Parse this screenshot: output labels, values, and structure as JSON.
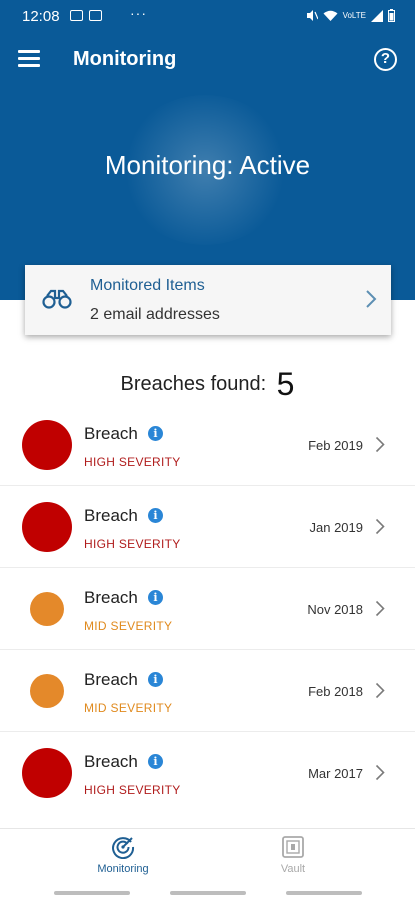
{
  "status_bar": {
    "time": "12:08",
    "more": "···",
    "right_text": "VoLTE"
  },
  "app_bar": {
    "title": "Monitoring",
    "menu_icon": "hamburger-menu-icon",
    "help_icon": "help-circle-icon",
    "help_glyph": "?"
  },
  "hero": {
    "status": "Monitoring: Active"
  },
  "monitored_items": {
    "title": "Monitored Items",
    "subtitle": "2 email addresses",
    "icon": "binoculars-icon"
  },
  "breaches": {
    "label": "Breaches found:",
    "count": "5",
    "items": [
      {
        "name": "Breach",
        "severity": "HIGH SEVERITY",
        "date": "Feb 2019",
        "color": "#c00000"
      },
      {
        "name": "Breach",
        "severity": "HIGH SEVERITY",
        "date": "Jan 2019",
        "color": "#c00000"
      },
      {
        "name": "Breach",
        "severity": "MID SEVERITY",
        "date": "Nov 2018",
        "color": "#e4892a"
      },
      {
        "name": "Breach",
        "severity": "MID SEVERITY",
        "date": "Feb 2018",
        "color": "#e4892a"
      },
      {
        "name": "Breach",
        "severity": "HIGH SEVERITY",
        "date": "Mar 2017",
        "color": "#c00000"
      }
    ],
    "info_glyph": "i"
  },
  "bottom_nav": {
    "monitoring_label": "Monitoring",
    "vault_label": "Vault"
  },
  "colors": {
    "brand_blue": "#0a5a98",
    "high_severity": "#c00000",
    "high_severity_text": "#b01c1c",
    "mid_severity": "#e4892a",
    "mid_severity_text": "#e08a1e",
    "info_blue": "#2a86d6"
  }
}
